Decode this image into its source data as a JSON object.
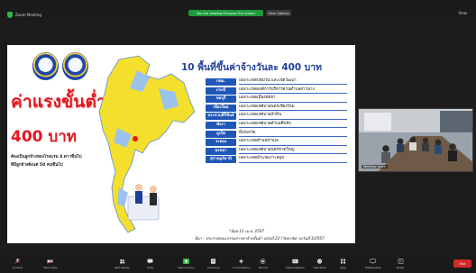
{
  "topbar": {
    "meeting_label": "Zoom Meeting",
    "share_banner": "You are viewing Fkanyaa Tu2 screen",
    "view_options": "View Options",
    "right_label": "View"
  },
  "slide": {
    "headline": "ค่าแรงขั้นต่ำ",
    "amount": "400 บาท",
    "condition_1": "ต้องเป็นลูกจ้างของโรงแรม 4 ดาวขึ้นไป",
    "condition_2": "ที่มีลูกจ้างตั้งแต่ 50 คนขึ้นไป",
    "title": "10 พื้นที่ขึ้นค่าจ้างวันละ 400 บาท",
    "rows": [
      {
        "province": "กทม.",
        "area": "เฉพาะเขตปทุมวัน และเขตวัฒนา"
      },
      {
        "province": "กระบี่",
        "area": "เฉพาะเขตองค์การบริหารส่วนตำบลอ่าวนาง"
      },
      {
        "province": "ชลบุรี",
        "area": "เฉพาะเขตเมืองพัทยา"
      },
      {
        "province": "เชียงใหม่",
        "area": "เฉพาะเขตเทศบาลนครเชียงใหม่"
      },
      {
        "province": "ประจวบคีรีขันธ์",
        "area": "เฉพาะเขตเทศบาลหัวหิน"
      },
      {
        "province": "พังงา",
        "area": "เฉพาะเขตเทศบาลตำบลคึกคัก"
      },
      {
        "province": "ภูเก็ต",
        "area": "ทั้งจังหวัด"
      },
      {
        "province": "ระยอง",
        "area": "เฉพาะเขตตำบลบ้านเพ"
      },
      {
        "province": "สงขลา",
        "area": "เฉพาะเขตเทศบาลนครหาดใหญ่"
      },
      {
        "province": "สุราษฎร์ธานี",
        "area": "เฉพาะเขตอำเภอเกาะสมุย"
      }
    ],
    "date": "*มีผล 13 เม.ย. 2567",
    "source": "ที่มา : ประกาศคณะกรรมการค่าจ้างขั้นต่ำ ฉบับที่ 22 (วิทยาลัย) ลงวันที่ 3/2567"
  },
  "video": {
    "participant": "Meeting room"
  },
  "toolbar": {
    "items": [
      {
        "icon": "microphone-icon",
        "label": "Unmute"
      },
      {
        "icon": "video-camera-icon",
        "label": "Start Video"
      },
      {
        "icon": "participants-icon",
        "label": "Participants"
      },
      {
        "icon": "chat-icon",
        "label": "Chat"
      },
      {
        "icon": "share-screen-icon",
        "label": "Share Screen"
      },
      {
        "icon": "summary-icon",
        "label": "Summary"
      },
      {
        "icon": "ai-companion-icon",
        "label": "AI Companion"
      },
      {
        "icon": "record-icon",
        "label": "Record"
      },
      {
        "icon": "captions-icon",
        "label": "Show Captions"
      },
      {
        "icon": "reactions-icon",
        "label": "Reactions"
      },
      {
        "icon": "apps-icon",
        "label": "Apps"
      },
      {
        "icon": "whiteboards-icon",
        "label": "Whiteboards"
      },
      {
        "icon": "notes-icon",
        "label": "Notes"
      }
    ],
    "end_label": "End"
  },
  "colors": {
    "accent_green": "#1f9b3b",
    "slide_red": "#e3161e",
    "slide_blue": "#1f57b8",
    "end_red": "#d22a2a"
  }
}
